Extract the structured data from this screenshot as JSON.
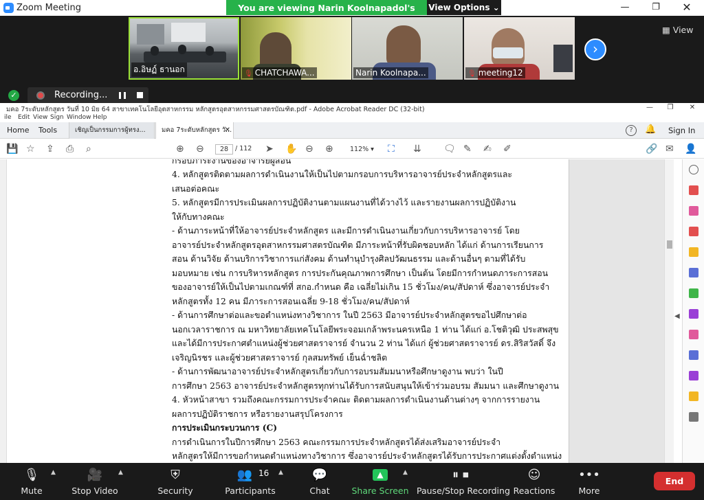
{
  "zoom": {
    "app_title": "Zoom Meeting",
    "viewing_banner": "You are viewing Narin Koolnapadol's screen",
    "view_options_label": "View Options ⌄",
    "view_label": "View",
    "recording_label": "Recording...",
    "participants": [
      {
        "name": "อ.อิษฏ์ ธานอก",
        "muted": false
      },
      {
        "name": "CHATCHAWA...",
        "muted": true
      },
      {
        "name": "Narin Koolnapa...",
        "muted": false
      },
      {
        "name": "meeting12",
        "muted": true
      }
    ],
    "controls": {
      "mute": "Mute",
      "stop_video": "Stop Video",
      "security": "Security",
      "participants": "Participants",
      "participants_count": "16",
      "chat": "Chat",
      "share_screen": "Share Screen",
      "pause_stop_recording": "Pause/Stop Recording",
      "reactions": "Reactions",
      "more": "More",
      "end": "End"
    }
  },
  "acrobat": {
    "title": "มคอ 7ระดับหลักสูตร วันที่ 10 มิย 64 สาขาเทคโนโลยีอุตสาหกรรม หลักสูตรอุตสาหกรรมศาสตรบัณฑิต.pdf - Adobe Acrobat Reader DC (32-bit)",
    "menu": [
      "ile",
      "Edit",
      "View",
      "Sign",
      "Window",
      "Help"
    ],
    "tabs": {
      "home": "Home",
      "tools": "Tools",
      "doc1": "เชิญเป็นกรรมการผู้ทรง...",
      "doc2": "มคอ 7ระดับหลักสูตร  วั..."
    },
    "sign_in": "Sign In",
    "page_current": "28",
    "page_total": "/  112",
    "zoom_level": "112%  ▾",
    "lines": [
      "กรอบภาระงานของอาจารย์ผู้สอน",
      "          4. หลักสูตรติดตามผลการดำเนินงานให้เป็นไปตามกรอบการบริหารอาจารย์ประจำหลักสูตรและ",
      "เสนอต่อคณะ",
      "          5. หลักสูตรมีการประเมินผลการปฏิบัติงานตามแผนงานที่ได้วางไว้ และรายงานผลการปฏิบัติงาน",
      "ให้กับทางคณะ",
      "          - ด้านภาระหน้าที่ให้อาจารย์ประจำหลักสูตร และมีการดำเนินงานเกี่ยวกับการบริหารอาจารย์ โดย",
      "อาจารย์ประจำหลักสูตรอุตสาหกรรมศาสตรบัณฑิต มีภาระหน้าที่รับผิดชอบหลัก ได้แก่ ด้านการเรียนการ",
      "สอน ด้านวิจัย ด้านบริการวิชาการแก่สังคม ด้านทำนุบำรุงศิลปวัฒนธรรม และด้านอื่นๆ ตามที่ได้รับ",
      "มอบหมาย เช่น การบริหารหลักสูตร การประกันคุณภาพการศึกษา เป็นต้น โดยมีการกำหนดภาระการสอน",
      "ของอาจารย์ให้เป็นไปตามเกณฑ์ที่ สกอ.กำหนด คือ เฉลี่ยไม่เกิน 15 ชั่วโมง/คน/สัปดาห์ ซึ่งอาจารย์ประจำ",
      "หลักสูตรทั้ง 12 คน มีภาระการสอนเฉลี่ย 9-18 ชั่วโมง/คน/สัปดาห์",
      "          - ด้านการศึกษาต่อและขอตำแหน่งทางวิชาการ ในปี 2563 มีอาจารย์ประจำหลักสูตรขอไปศึกษาต่อ",
      "นอกเวลาราชการ ณ มหาวิทยาลัยเทคโนโลยีพระจอมเกล้าพระนครเหนือ 1 ท่าน ได้แก่ อ.โชติวุฒิ ประสพสุข",
      "และได้มีการประกาศตำแหน่งผู้ช่วยศาสตราจารย์ จำนวน 2 ท่าน ได้แก่ ผู้ช่วยศาสตราจารย์ ดร.สิริสวัสดิ์ จึง",
      "เจริญนิรชร และผู้ช่วยศาสตราจารย์ กุลสมทรัพย์ เย็นฉ่ำชลิต",
      "          - ด้านการพัฒนาอาจารย์ประจำหลักสูตรเกี่ยวกับการอบรมสัมมนาหรือศึกษาดูงาน พบว่า ในปี",
      "การศึกษา 2563 อาจารย์ประจำหลักสูตรทุกท่านได้รับการสนับสนุนให้เข้าร่วมอบรม สัมมนา และศึกษาดูงาน",
      "          4. หัวหน้าสาขา รวมถึงคณะกรรมการประจำคณะ ติดตามผลการดำเนินงานด้านต่างๆ จากการรายงาน",
      "ผลการปฏิบัติราชการ หรือรายงานสรุปโครงการ",
      "การประเมินกระบวนการ (C)",
      "          การดำเนินการในปีการศึกษา 2563 คณะกรรมการประจำหลักสูตรได้ส่งเสริมอาจารย์ประจำ",
      "หลักสูตรให้มีการขอกำหนดตำแหน่งทางวิชาการ ซึ่งอาจารย์ประจำหลักสูตรได้รับการประกาศแต่งตั้งตำแหน่ง"
    ]
  }
}
